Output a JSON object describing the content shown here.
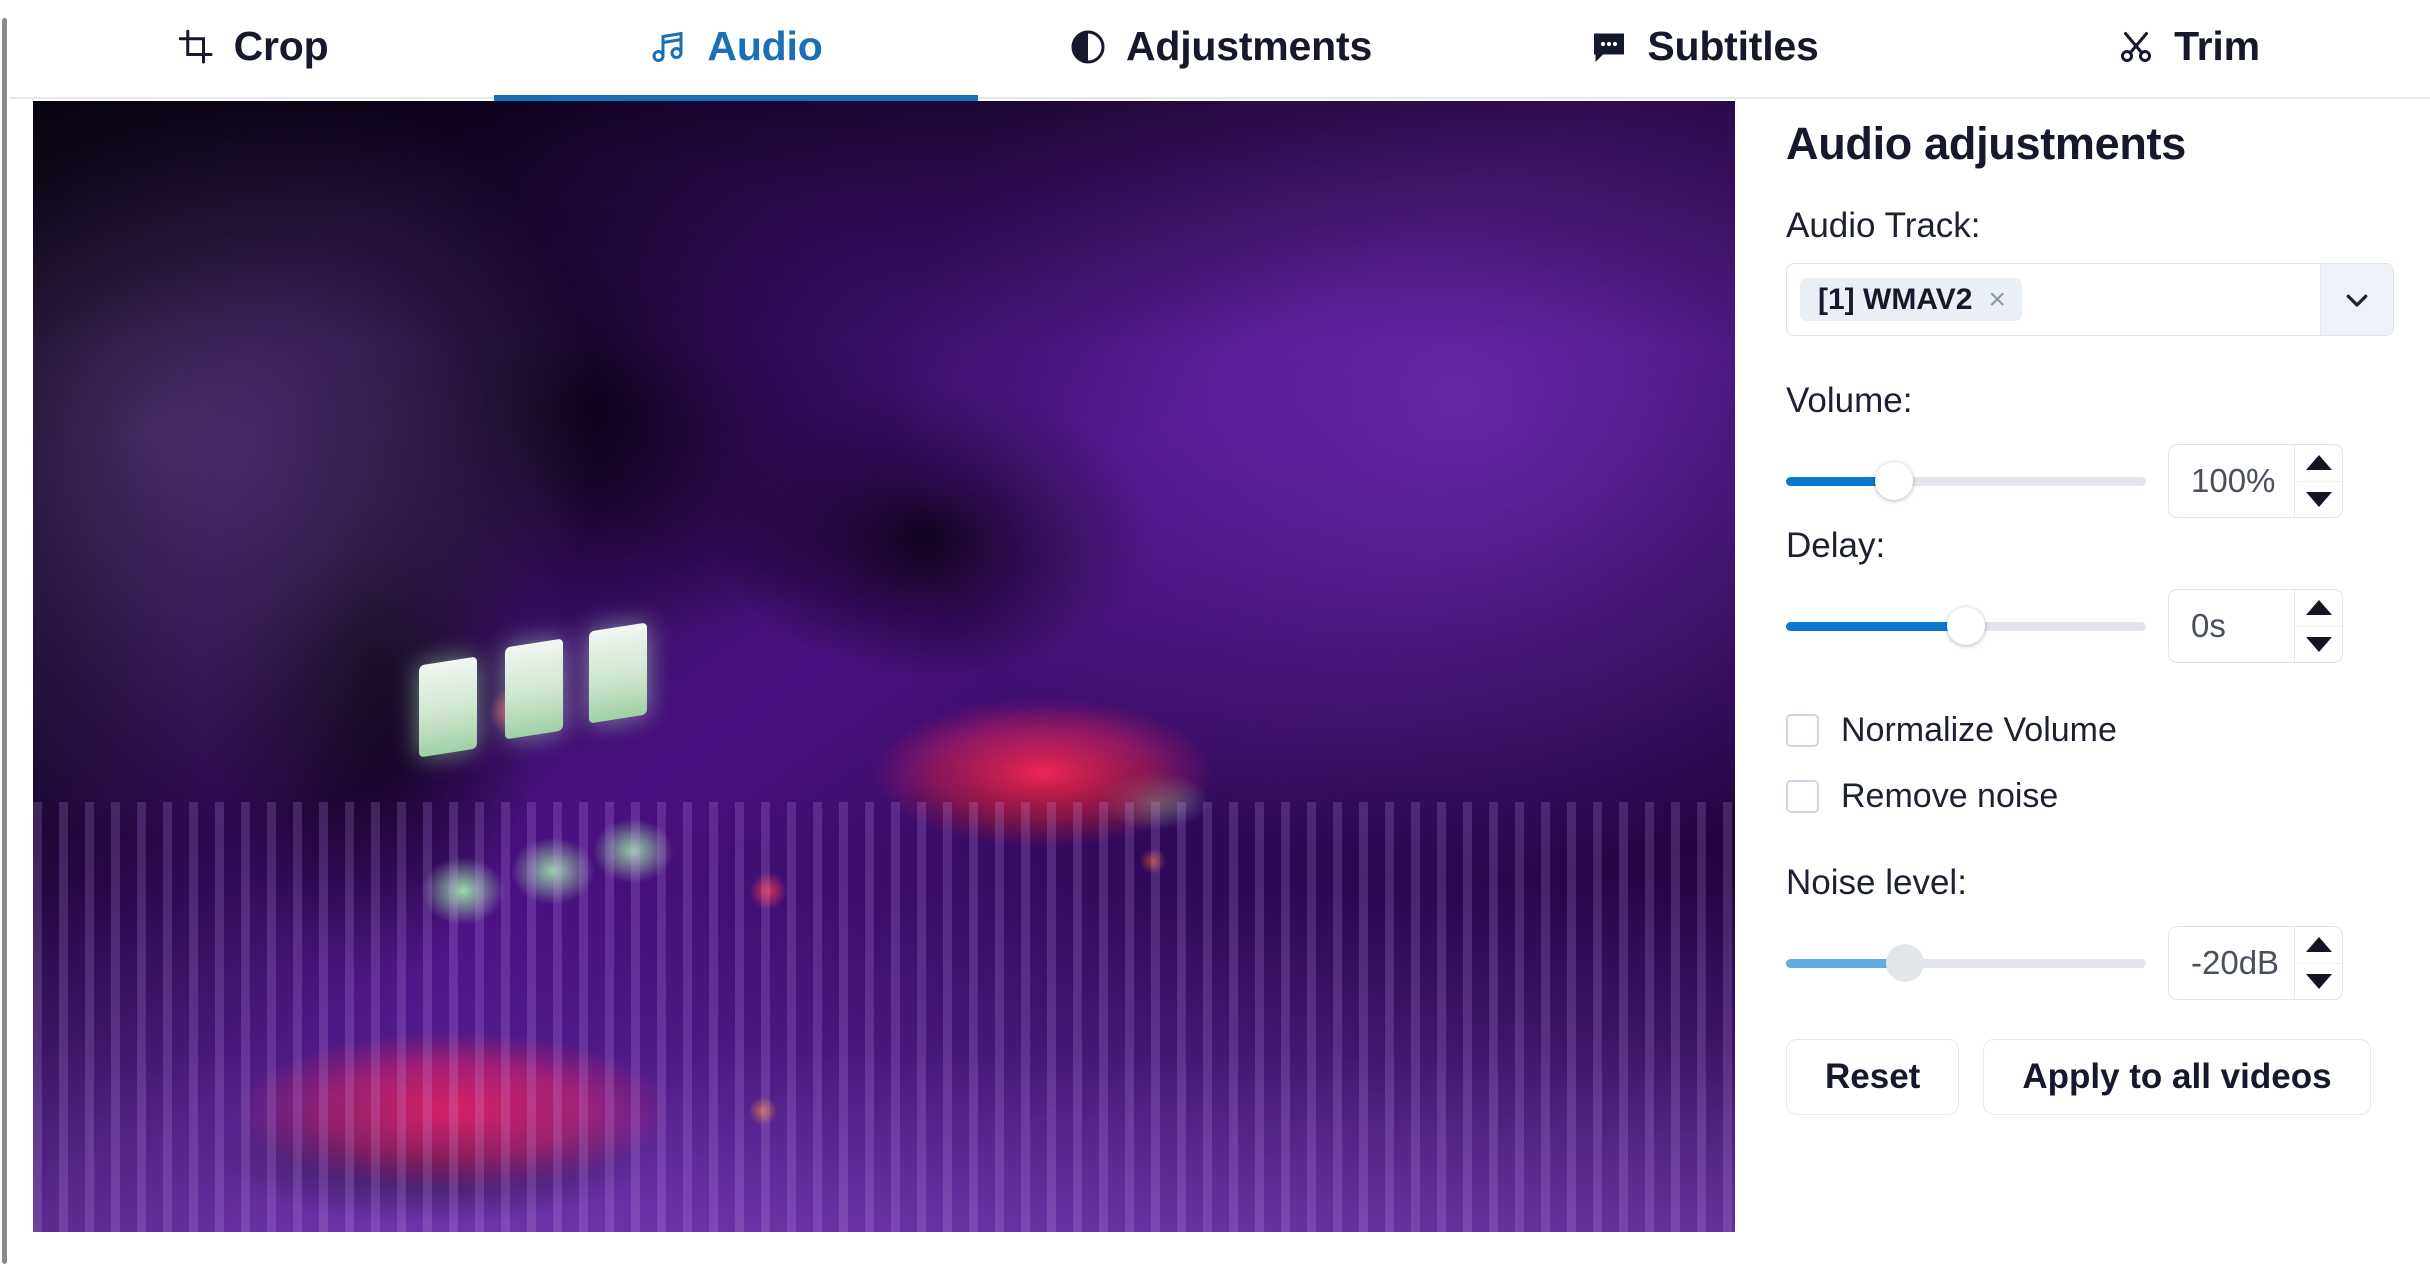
{
  "tabs": [
    {
      "id": "crop",
      "label": "Crop",
      "icon": "crop-icon",
      "active": false
    },
    {
      "id": "audio",
      "label": "Audio",
      "icon": "music-note-icon",
      "active": true
    },
    {
      "id": "adjustments",
      "label": "Adjustments",
      "icon": "contrast-icon",
      "active": false
    },
    {
      "id": "subtitles",
      "label": "Subtitles",
      "icon": "speech-bubble-icon",
      "active": false
    },
    {
      "id": "trim",
      "label": "Trim",
      "icon": "scissors-icon",
      "active": false
    }
  ],
  "preview": {
    "alt": "DJ mixer with glowing red jog wheels under purple lighting and a silhouetted hand"
  },
  "panel": {
    "title": "Audio adjustments",
    "audio_track": {
      "label": "Audio Track:",
      "chips": [
        {
          "text": "[1] WMAV2",
          "remove_label": "×"
        }
      ],
      "caret_icon": "chevron-down-icon"
    },
    "volume": {
      "label": "Volume:",
      "value": "100%",
      "slider_percent": 30,
      "disabled": false
    },
    "delay": {
      "label": "Delay:",
      "value": "0s",
      "slider_percent": 50,
      "disabled": false
    },
    "checkboxes": [
      {
        "id": "normalize-volume",
        "label": "Normalize Volume",
        "checked": false
      },
      {
        "id": "remove-noise",
        "label": "Remove noise",
        "checked": false
      }
    ],
    "noise_level": {
      "label": "Noise level:",
      "value": "-20dB",
      "slider_percent": 33,
      "disabled": true
    },
    "buttons": [
      {
        "id": "reset",
        "label": "Reset"
      },
      {
        "id": "apply-all-videos",
        "label": "Apply to all videos"
      }
    ]
  },
  "colors": {
    "accent": "#1a6fb5",
    "slider_fill": "#0a78cf",
    "slider_fill_disabled": "#62ace0",
    "track": "#e2e6ec",
    "text": "#16192b",
    "chip_bg": "#eaeef5"
  }
}
